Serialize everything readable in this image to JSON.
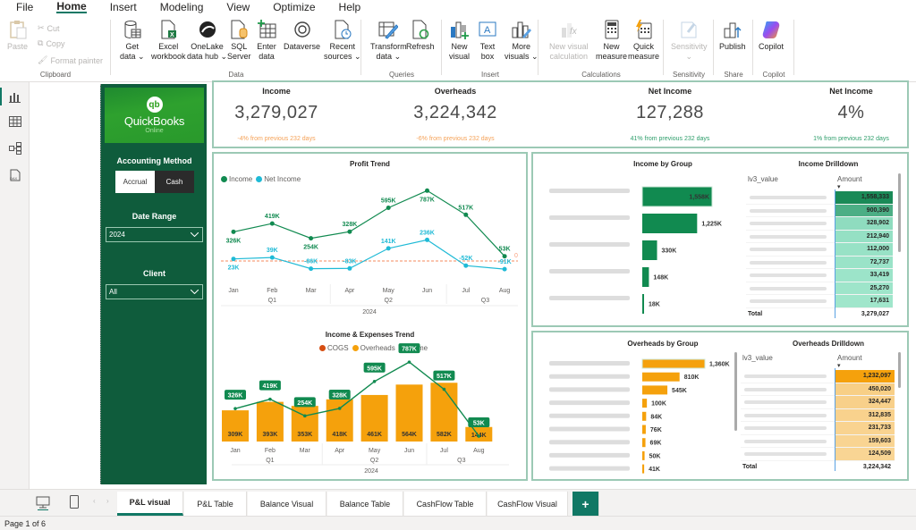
{
  "menu": [
    "File",
    "Home",
    "Insert",
    "Modeling",
    "View",
    "Optimize",
    "Help"
  ],
  "menu_active": "Home",
  "ribbon": {
    "clipboard": {
      "paste": "Paste",
      "cut": "Cut",
      "copy": "Copy",
      "format_painter": "Format painter",
      "group": "Clipboard"
    },
    "data": {
      "group": "Data",
      "buttons": [
        {
          "l1": "Get",
          "l2": "data ⌄",
          "icon": "get-data-icon"
        },
        {
          "l1": "Excel",
          "l2": "workbook",
          "icon": "excel-icon"
        },
        {
          "l1": "OneLake",
          "l2": "data hub ⌄",
          "icon": "onelake-icon"
        },
        {
          "l1": "SQL",
          "l2": "Server",
          "icon": "sql-server-icon"
        },
        {
          "l1": "Enter",
          "l2": "data",
          "icon": "enter-data-icon"
        },
        {
          "l1": "Dataverse",
          "l2": "",
          "icon": "dataverse-icon"
        },
        {
          "l1": "Recent",
          "l2": "sources ⌄",
          "icon": "recent-sources-icon"
        }
      ]
    },
    "queries": {
      "group": "Queries",
      "buttons": [
        {
          "l1": "Transform",
          "l2": "data ⌄",
          "icon": "transform-data-icon"
        },
        {
          "l1": "Refresh",
          "l2": "",
          "icon": "refresh-icon"
        }
      ]
    },
    "insert": {
      "group": "Insert",
      "buttons": [
        {
          "l1": "New",
          "l2": "visual",
          "icon": "new-visual-icon"
        },
        {
          "l1": "Text",
          "l2": "box",
          "icon": "text-box-icon"
        },
        {
          "l1": "More",
          "l2": "visuals ⌄",
          "icon": "more-visuals-icon"
        }
      ]
    },
    "calculations": {
      "group": "Calculations",
      "buttons": [
        {
          "l1": "New visual",
          "l2": "calculation",
          "icon": "new-visual-calculation-icon",
          "disabled": true
        },
        {
          "l1": "New",
          "l2": "measure",
          "icon": "new-measure-icon"
        },
        {
          "l1": "Quick",
          "l2": "measure",
          "icon": "quick-measure-icon"
        }
      ]
    },
    "sensitivity": {
      "group": "Sensitivity",
      "buttons": [
        {
          "l1": "Sensitivity",
          "l2": "⌄",
          "icon": "sensitivity-icon",
          "disabled": true
        }
      ]
    },
    "share": {
      "group": "Share",
      "buttons": [
        {
          "l1": "Publish",
          "l2": "",
          "icon": "publish-icon"
        }
      ]
    },
    "copilot": {
      "group": "Copilot",
      "buttons": [
        {
          "l1": "Copilot",
          "l2": "",
          "icon": "copilot-icon"
        }
      ]
    }
  },
  "sidebar": {
    "logo_text": "QuickBooks",
    "logo_sub": "Online",
    "logo_mark": "qb",
    "accounting_method_label": "Accounting Method",
    "accounting_options": [
      "Accrual",
      "Cash"
    ],
    "accounting_selected": "Accrual",
    "date_range_label": "Date Range",
    "date_range_value": "2024",
    "client_label": "Client",
    "client_value": "All"
  },
  "kpis": [
    {
      "title": "Income",
      "value": "3,279,027",
      "delta": "-4% from previous 232 days",
      "trend": "down"
    },
    {
      "title": "Overheads",
      "value": "3,224,342",
      "delta": "-6% from previous 232 days",
      "trend": "down"
    },
    {
      "title": "Net Income",
      "value": "127,288",
      "delta": "41% from previous 232 days",
      "trend": "up"
    },
    {
      "title": "Net Income",
      "value": "4%",
      "delta": "1% from previous 232 days",
      "trend": "up"
    }
  ],
  "colors": {
    "income": "#118a50",
    "net_income": "#1fbad6",
    "overheads": "#f5a10c",
    "cogs": "#d64e12",
    "brand": "#117865",
    "zero_line": "#f8a07e",
    "down": "#f5a258",
    "up": "#2e9e6b"
  },
  "chart_data": [
    {
      "type": "line",
      "title": "Profit Trend",
      "x": [
        "Jan",
        "Feb",
        "Mar",
        "Apr",
        "May",
        "Jun",
        "Jul",
        "Aug"
      ],
      "x_groups": [
        {
          "label": "Q1",
          "span": 3
        },
        {
          "label": "Q2",
          "span": 3
        },
        {
          "label": "Q3",
          "span": 2
        }
      ],
      "x_year": "2024",
      "series": [
        {
          "name": "Income",
          "values": [
            326,
            419,
            254,
            328,
            595,
            787,
            517,
            53
          ],
          "labels": [
            "326K",
            "419K",
            "254K",
            "328K",
            "595K",
            "787K",
            "517K",
            "53K"
          ]
        },
        {
          "name": "Net Income",
          "values": [
            23,
            39,
            -86,
            -83,
            141,
            236,
            -52,
            -91
          ],
          "labels": [
            "23K",
            "39K",
            "-86K",
            "-83K",
            "141K",
            "236K",
            "-52K",
            "-91K"
          ]
        }
      ],
      "reference_line": {
        "value": 0,
        "label": "0"
      },
      "legend": "top-left"
    },
    {
      "type": "bar",
      "title": "Income & Expenses Trend",
      "x": [
        "Jan",
        "Feb",
        "Mar",
        "Apr",
        "May",
        "Jun",
        "Jul",
        "Aug"
      ],
      "x_groups": [
        {
          "label": "Q1",
          "span": 3
        },
        {
          "label": "Q2",
          "span": 3
        },
        {
          "label": "Q3",
          "span": 2
        }
      ],
      "x_year": "2024",
      "legend_items": [
        "COGS",
        "Overheads",
        "Income"
      ],
      "series": [
        {
          "name": "Overheads",
          "kind": "bar",
          "values": [
            309,
            393,
            353,
            418,
            461,
            564,
            582,
            144
          ],
          "labels": [
            "309K",
            "393K",
            "353K",
            "418K",
            "461K",
            "564K",
            "582K",
            "144K"
          ]
        },
        {
          "name": "Income",
          "kind": "line",
          "values": [
            326,
            419,
            254,
            328,
            595,
            787,
            517,
            53
          ],
          "labels": [
            "326K",
            "419K",
            "254K",
            "328K",
            "595K",
            "787K",
            "517K",
            "53K"
          ]
        }
      ],
      "legend": "top-center"
    },
    {
      "type": "bar",
      "orientation": "horizontal",
      "title": "Income by Group",
      "values": [
        1558,
        1225,
        330,
        148,
        18
      ],
      "labels": [
        "1,558K",
        "1,225K",
        "330K",
        "148K",
        "18K"
      ]
    },
    {
      "type": "table",
      "title": "Income Drilldown",
      "columns": [
        "lv3_value",
        "Amount"
      ],
      "values": [
        "1,558,333",
        "900,390",
        "328,902",
        "212,940",
        "112,000",
        "72,737",
        "33,419",
        "25,270",
        "17,631"
      ],
      "total_label": "Total",
      "total": "3,279,027"
    },
    {
      "type": "bar",
      "orientation": "horizontal",
      "title": "Overheads by Group",
      "values": [
        1360,
        810,
        545,
        100,
        84,
        76,
        69,
        50,
        41
      ],
      "labels": [
        "1,360K",
        "810K",
        "545K",
        "100K",
        "84K",
        "76K",
        "69K",
        "50K",
        "41K"
      ]
    },
    {
      "type": "table",
      "title": "Overheads Drilldown",
      "columns": [
        "lv3_value",
        "Amount"
      ],
      "values": [
        "1,232,097",
        "450,020",
        "324,447",
        "312,835",
        "231,733",
        "159,603",
        "124,509"
      ],
      "total_label": "Total",
      "total": "3,224,342"
    }
  ],
  "tabs": [
    "P&L visual",
    "P&L Table",
    "Balance Visual",
    "Balance Table",
    "CashFlow Table",
    "CashFlow Visual"
  ],
  "active_tab": "P&L visual",
  "add_tab": "+",
  "status": "Page 1 of 6"
}
